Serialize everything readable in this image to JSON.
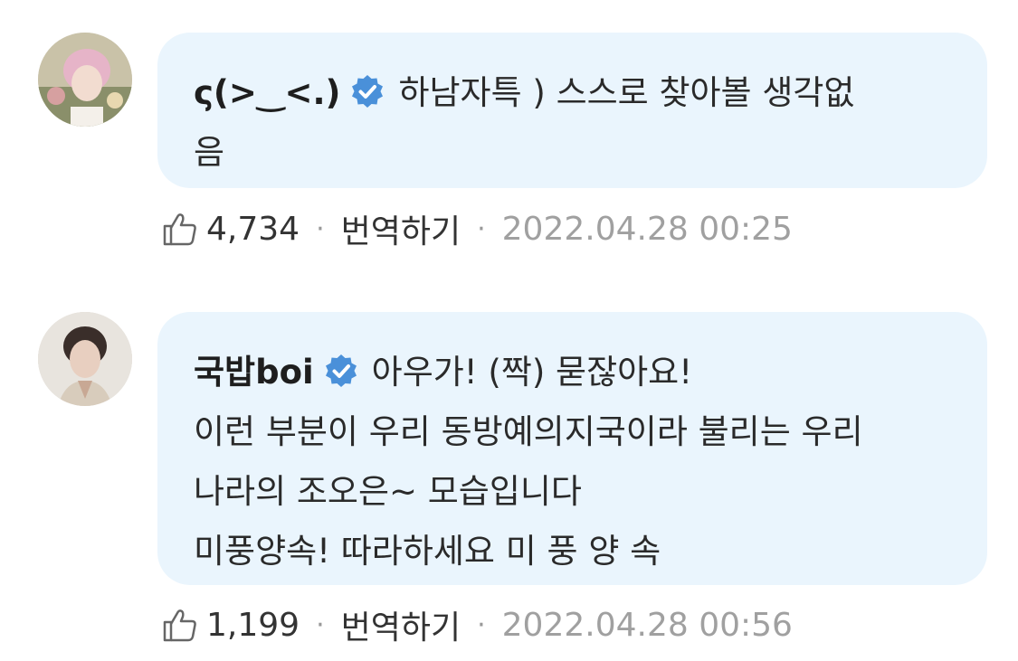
{
  "comments": [
    {
      "nickname": "ς(>‿<.)",
      "text_lines": [
        "하남자특 ) 스스로 찾아볼 생각없",
        "음"
      ],
      "likes": "4,734",
      "translate_label": "번역하기",
      "timestamp": "2022.04.28 00:25",
      "separator": "·"
    },
    {
      "nickname": "국밥boi",
      "text_lines": [
        "아우가! (짝) 묻잖아요!",
        "이런 부분이 우리 동방예의지국이라 불리는 우리",
        "나라의 조오은~ 모습입니다",
        "미풍양속! 따라하세요 미 풍 양 속"
      ],
      "likes": "1,199",
      "translate_label": "번역하기",
      "timestamp": "2022.04.28 00:56",
      "separator": "·"
    }
  ],
  "colors": {
    "bubble": "#eaf5fd",
    "verified": "#4a90d9",
    "timestamp": "#a0a0a0"
  },
  "icons": {
    "like": "thumbs-up-icon",
    "verified": "verified-badge-icon"
  }
}
